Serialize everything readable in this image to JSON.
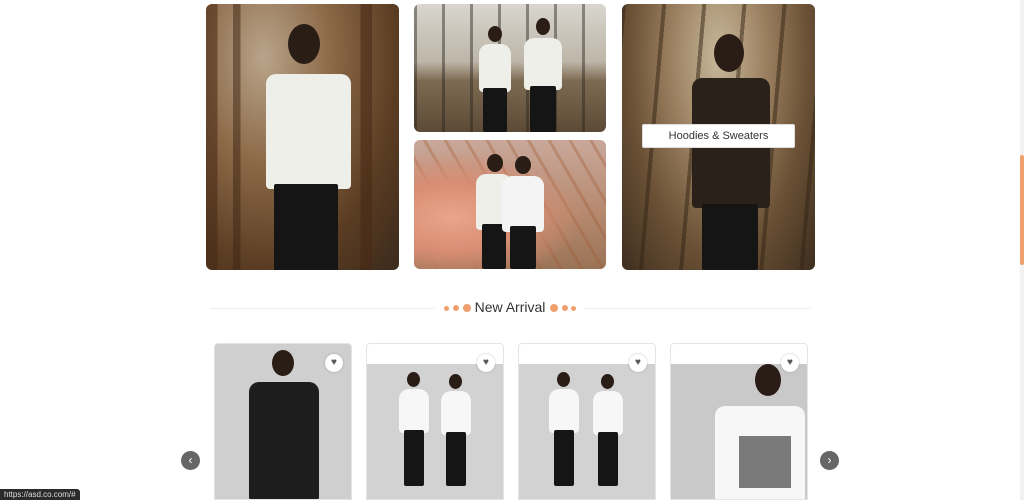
{
  "gallery": {
    "category_label": "Hoodies & Sweaters"
  },
  "new_arrival": {
    "title": "New Arrival"
  },
  "products": [
    {
      "name": "black sweatshirt",
      "wishlist_icon": "heart-icon"
    },
    {
      "name": "two white tees",
      "wishlist_icon": "heart-icon"
    },
    {
      "name": "two white printed tees",
      "wishlist_icon": "heart-icon"
    },
    {
      "name": "portrait tee",
      "wishlist_icon": "heart-icon"
    }
  ],
  "carousel": {
    "prev_icon": "chevron-left-icon",
    "next_icon": "chevron-right-icon"
  },
  "status_bar": {
    "url": "https://asd.co.com/#"
  },
  "colors": {
    "accent": "#f0a06c"
  }
}
